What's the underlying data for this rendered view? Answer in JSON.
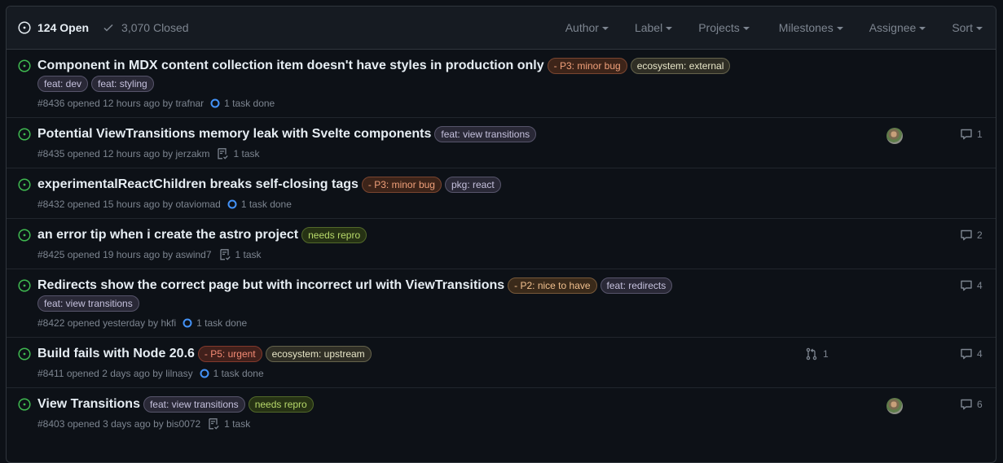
{
  "header": {
    "open_count_label": "124 Open",
    "closed_count_label": "3,070 Closed",
    "filters": [
      "Author",
      "Label",
      "Projects",
      "Milestones",
      "Assignee",
      "Sort"
    ]
  },
  "colors": {
    "open_green": "#3fb950",
    "task_blue": "#4493f8"
  },
  "issues": [
    {
      "title": "Component in MDX content collection item doesn't have styles in production only",
      "labels_inline": [
        {
          "text": "- P3: minor bug",
          "fg": "#f0a07a",
          "bg": "#3d2419",
          "border": "#7a4530"
        },
        {
          "text": "ecosystem: external",
          "fg": "#e8e6c8",
          "bg": "#2f2e25",
          "border": "#65634c"
        }
      ],
      "labels_wrap": [
        {
          "text": "feat: dev",
          "fg": "#c5c1dd",
          "bg": "#292836",
          "border": "#57556b"
        },
        {
          "text": "feat: styling",
          "fg": "#c5c1dd",
          "bg": "#292836",
          "border": "#57556b"
        }
      ],
      "meta": "#8436 opened 12 hours ago by trafnar",
      "task_icon": "progress-circle-icon",
      "task": "1 task done",
      "assignee": false,
      "comments": null,
      "linked_pr": null
    },
    {
      "title": "Potential ViewTransitions memory leak with Svelte components",
      "labels_inline": [
        {
          "text": "feat: view transitions",
          "fg": "#c5c1dd",
          "bg": "#292836",
          "border": "#57556b"
        }
      ],
      "labels_wrap": [],
      "meta": "#8435 opened 12 hours ago by jerzakm",
      "task_icon": "checklist-icon",
      "task": "1 task",
      "assignee": true,
      "comments": "1",
      "linked_pr": null
    },
    {
      "title": "experimentalReactChildren breaks self-closing tags",
      "labels_inline": [
        {
          "text": "- P3: minor bug",
          "fg": "#f0a07a",
          "bg": "#3d2419",
          "border": "#7a4530"
        },
        {
          "text": "pkg: react",
          "fg": "#c5c1dd",
          "bg": "#292836",
          "border": "#57556b"
        }
      ],
      "labels_wrap": [],
      "meta": "#8432 opened 15 hours ago by otaviomad",
      "task_icon": "progress-circle-icon",
      "task": "1 task done",
      "assignee": false,
      "comments": null,
      "linked_pr": null
    },
    {
      "title": "an error tip when i create the astro project",
      "labels_inline": [
        {
          "text": "needs repro",
          "fg": "#b7d96a",
          "bg": "#263214",
          "border": "#52692a"
        }
      ],
      "labels_wrap": [],
      "meta": "#8425 opened 19 hours ago by aswind7",
      "task_icon": "checklist-icon",
      "task": "1 task",
      "assignee": false,
      "comments": "2",
      "linked_pr": null
    },
    {
      "title": "Redirects show the correct page but with incorrect url with ViewTransitions",
      "labels_inline": [
        {
          "text": "- P2: nice to have",
          "fg": "#f1c08e",
          "bg": "#3a2a1a",
          "border": "#77593a"
        },
        {
          "text": "feat: redirects",
          "fg": "#c5c1dd",
          "bg": "#292836",
          "border": "#57556b"
        }
      ],
      "labels_wrap": [
        {
          "text": "feat: view transitions",
          "fg": "#c5c1dd",
          "bg": "#292836",
          "border": "#57556b"
        }
      ],
      "meta": "#8422 opened yesterday by hkfi",
      "task_icon": "progress-circle-icon",
      "task": "1 task done",
      "assignee": false,
      "comments": "4",
      "linked_pr": null
    },
    {
      "title": "Build fails with Node 20.6",
      "labels_inline": [
        {
          "text": "- P5: urgent",
          "fg": "#f48a74",
          "bg": "#41201b",
          "border": "#83392c"
        },
        {
          "text": "ecosystem: upstream",
          "fg": "#e8e6c8",
          "bg": "#2f2e25",
          "border": "#65634c"
        }
      ],
      "labels_wrap": [],
      "meta": "#8411 opened 2 days ago by lilnasy",
      "task_icon": "progress-circle-icon",
      "task": "1 task done",
      "assignee": false,
      "comments": "4",
      "linked_pr": "1"
    },
    {
      "title": "View Transitions",
      "labels_inline": [
        {
          "text": "feat: view transitions",
          "fg": "#c5c1dd",
          "bg": "#292836",
          "border": "#57556b"
        },
        {
          "text": "needs repro",
          "fg": "#b7d96a",
          "bg": "#263214",
          "border": "#52692a"
        }
      ],
      "labels_wrap": [],
      "meta": "#8403 opened 3 days ago by bis0072",
      "task_icon": "checklist-icon",
      "task": "1 task",
      "assignee": true,
      "comments": "6",
      "linked_pr": null
    }
  ]
}
